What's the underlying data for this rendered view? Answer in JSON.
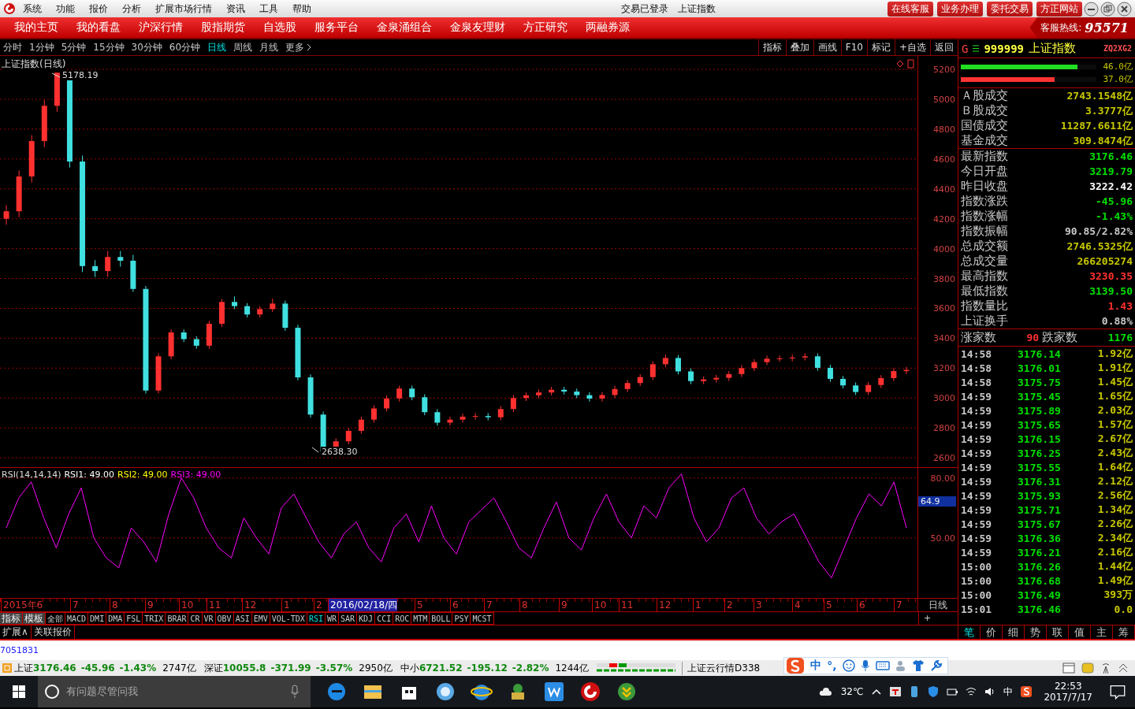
{
  "title_bar": {
    "menus": [
      "系统",
      "功能",
      "报价",
      "分析",
      "扩展市场行情",
      "资讯",
      "工具",
      "帮助"
    ],
    "status": "交易已登录",
    "security": "上证指数",
    "links": [
      "在线客服",
      "业务办理",
      "委托交易",
      "方正网站"
    ]
  },
  "nav": {
    "items": [
      "我的主页",
      "我的看盘",
      "沪深行情",
      "股指期货",
      "自选股",
      "服务平台",
      "金泉涌组合",
      "金泉友理财",
      "方正研究",
      "两融券源"
    ],
    "hotline_label": "客服热线:",
    "hotline": "95571"
  },
  "periods": [
    {
      "label": "分时",
      "selected": false
    },
    {
      "label": "1分钟",
      "selected": false
    },
    {
      "label": "5分钟",
      "selected": false
    },
    {
      "label": "15分钟",
      "selected": false
    },
    {
      "label": "30分钟",
      "selected": false
    },
    {
      "label": "60分钟",
      "selected": false
    },
    {
      "label": "日线",
      "selected": true
    },
    {
      "label": "周线",
      "selected": false
    },
    {
      "label": "月线",
      "selected": false
    },
    {
      "label": "更多",
      "selected": false
    }
  ],
  "chart_tools": [
    "指标",
    "叠加",
    "画线",
    "F10",
    "标记",
    "+自选",
    "返回"
  ],
  "quote_header": {
    "market": "G",
    "code": "999999",
    "name": "上证指数",
    "tag": "ZQ2XG2"
  },
  "flow_bars": [
    {
      "level": 0.86,
      "reading": "46.0亿",
      "color": "#22dd22"
    },
    {
      "level": 0.69,
      "reading": "37.0亿",
      "color": "#ff3333"
    }
  ],
  "turnover": [
    {
      "label": "Ａ股成交",
      "value": "2743.1548亿"
    },
    {
      "label": "Ｂ股成交",
      "value": "3.3777亿"
    },
    {
      "label": "国债成交",
      "value": "11287.6611亿"
    },
    {
      "label": "基金成交",
      "value": "309.8474亿"
    }
  ],
  "stats": [
    {
      "label": "最新指数",
      "value": "3176.46",
      "kind": "down"
    },
    {
      "label": "今日开盘",
      "value": "3219.79",
      "kind": "down"
    },
    {
      "label": "昨日收盘",
      "value": "3222.42",
      "kind": "flat"
    },
    {
      "label": "指数涨跌",
      "value": "-45.96",
      "kind": "down"
    },
    {
      "label": "指数涨幅",
      "value": "-1.43%",
      "kind": "down"
    },
    {
      "label": "指数振幅",
      "value": "90.85/2.82%",
      "kind": "plain"
    },
    {
      "label": "总成交额",
      "value": "2746.5325亿",
      "kind": "amount"
    },
    {
      "label": "总成交量",
      "value": "266205274",
      "kind": "amount"
    },
    {
      "label": "最高指数",
      "value": "3230.35",
      "kind": "up"
    },
    {
      "label": "最低指数",
      "value": "3139.50",
      "kind": "down"
    },
    {
      "label": "指数量比",
      "value": "1.43",
      "kind": "up"
    },
    {
      "label": "上证换手",
      "value": "0.88%",
      "kind": "plain"
    }
  ],
  "breadth": {
    "up_label": "涨家数",
    "up": "90",
    "down_label": "跌家数",
    "down": "1176"
  },
  "ticks": [
    {
      "time": "14:58",
      "price": "3176.14",
      "volume": "1.92亿"
    },
    {
      "time": "14:58",
      "price": "3176.01",
      "volume": "1.91亿"
    },
    {
      "time": "14:58",
      "price": "3175.75",
      "volume": "1.45亿"
    },
    {
      "time": "14:59",
      "price": "3175.45",
      "volume": "1.65亿"
    },
    {
      "time": "14:59",
      "price": "3175.89",
      "volume": "2.03亿"
    },
    {
      "time": "14:59",
      "price": "3175.65",
      "volume": "1.57亿"
    },
    {
      "time": "14:59",
      "price": "3176.15",
      "volume": "2.67亿"
    },
    {
      "time": "14:59",
      "price": "3176.25",
      "volume": "2.43亿"
    },
    {
      "time": "14:59",
      "price": "3175.55",
      "volume": "1.64亿"
    },
    {
      "time": "14:59",
      "price": "3176.31",
      "volume": "2.12亿"
    },
    {
      "time": "14:59",
      "price": "3175.93",
      "volume": "2.56亿"
    },
    {
      "time": "14:59",
      "price": "3175.71",
      "volume": "1.34亿"
    },
    {
      "time": "14:59",
      "price": "3175.67",
      "volume": "2.26亿"
    },
    {
      "time": "14:59",
      "price": "3176.36",
      "volume": "2.34亿"
    },
    {
      "time": "14:59",
      "price": "3176.21",
      "volume": "2.16亿"
    },
    {
      "time": "15:00",
      "price": "3176.26",
      "volume": "1.44亿"
    },
    {
      "time": "15:00",
      "price": "3176.68",
      "volume": "1.49亿"
    },
    {
      "time": "15:00",
      "price": "3176.49",
      "volume": "393万"
    },
    {
      "time": "15:01",
      "price": "3176.46",
      "volume": "0.0"
    }
  ],
  "detail_tabs": [
    {
      "label": "笔",
      "selected": true
    },
    {
      "label": "价",
      "selected": false
    },
    {
      "label": "细",
      "selected": false
    },
    {
      "label": "势",
      "selected": false
    },
    {
      "label": "联",
      "selected": false
    },
    {
      "label": "值",
      "selected": false
    },
    {
      "label": "主",
      "selected": false
    },
    {
      "label": "筹",
      "selected": false
    }
  ],
  "main_chart": {
    "title": "上证指数(日线)",
    "high": "5178.19",
    "low": "2638.30",
    "chart_data": {
      "type": "candlestick",
      "grid": true,
      "ylim": [
        2537,
        5290
      ],
      "yticks": [
        {
          "value": 5200,
          "label": "5200"
        },
        {
          "value": 5000,
          "label": "5000"
        },
        {
          "value": 4800,
          "label": "4800"
        },
        {
          "value": 4600,
          "label": "4600"
        },
        {
          "value": 4400,
          "label": "4400"
        },
        {
          "value": 4200,
          "label": "4200"
        },
        {
          "value": 4000,
          "label": "4000"
        },
        {
          "value": 3800,
          "label": "3800"
        },
        {
          "value": 3600,
          "label": "3600"
        },
        {
          "value": 3400,
          "label": "3400"
        },
        {
          "value": 3200,
          "label": "3200"
        },
        {
          "value": 3000,
          "label": "3000"
        },
        {
          "value": 2800,
          "label": "2800"
        },
        {
          "value": 2600,
          "label": "2600"
        }
      ],
      "categories": [
        null,
        null,
        null,
        null,
        null,
        null,
        null,
        null,
        null,
        null,
        null,
        null,
        null,
        null,
        null,
        null,
        null,
        null,
        null,
        null,
        null,
        null,
        null,
        null,
        null,
        null,
        null,
        null,
        null,
        null,
        null,
        null,
        null,
        null,
        null,
        null,
        null,
        null,
        null,
        null,
        null,
        null,
        null,
        null,
        null,
        null,
        null,
        null,
        null,
        null,
        null,
        null,
        null,
        null,
        null,
        null,
        null,
        null,
        null,
        null,
        null,
        null,
        null,
        null,
        null,
        null,
        null,
        null,
        null,
        null,
        null,
        null
      ],
      "ohlc": [
        [
          4200,
          4290,
          4160,
          4250
        ],
        [
          4250,
          4523,
          4210,
          4483
        ],
        [
          4483,
          4760,
          4443,
          4720
        ],
        [
          4720,
          4996,
          4680,
          4956
        ],
        [
          4956,
          5178,
          4916,
          5178
        ],
        [
          5178,
          5178,
          4543,
          4583
        ],
        [
          4583,
          4623,
          3843,
          3883
        ],
        [
          3883,
          3923,
          3810,
          3850
        ],
        [
          3850,
          3984,
          3810,
          3944
        ],
        [
          3944,
          3984,
          3879,
          3919
        ],
        [
          3919,
          3959,
          3710,
          3730
        ],
        [
          3730,
          3750,
          3030,
          3050
        ],
        [
          3050,
          3299,
          3030,
          3279
        ],
        [
          3279,
          3459,
          3259,
          3439
        ],
        [
          3439,
          3459,
          3374,
          3394
        ],
        [
          3394,
          3414,
          3330,
          3350
        ],
        [
          3350,
          3517,
          3330,
          3497
        ],
        [
          3497,
          3663,
          3477,
          3643
        ],
        [
          3643,
          3680,
          3595,
          3615
        ],
        [
          3615,
          3635,
          3539,
          3559
        ],
        [
          3559,
          3615,
          3539,
          3595
        ],
        [
          3595,
          3665,
          3575,
          3632
        ],
        [
          3632,
          3652,
          3450,
          3470
        ],
        [
          3470,
          3490,
          3118,
          3138
        ],
        [
          3138,
          3158,
          2869,
          2889
        ],
        [
          2889,
          2909,
          2638,
          2640
        ],
        [
          2640,
          2730,
          2638,
          2710
        ],
        [
          2710,
          2800,
          2690,
          2780
        ],
        [
          2780,
          2875,
          2760,
          2855
        ],
        [
          2855,
          2950,
          2835,
          2930
        ],
        [
          2930,
          3017,
          2910,
          2997
        ],
        [
          2997,
          3083,
          2977,
          3063
        ],
        [
          3063,
          3083,
          2985,
          3005
        ],
        [
          3005,
          3025,
          2885,
          2905
        ],
        [
          2905,
          2925,
          2815,
          2835
        ],
        [
          2835,
          2875,
          2815,
          2855
        ],
        [
          2855,
          2895,
          2835,
          2875
        ],
        [
          2875,
          2899,
          2855,
          2879
        ],
        [
          2879,
          2899,
          2851,
          2871
        ],
        [
          2871,
          2946,
          2851,
          2926
        ],
        [
          2926,
          3020,
          2906,
          3000
        ],
        [
          3000,
          3038,
          2980,
          3018
        ],
        [
          3018,
          3057,
          2998,
          3037
        ],
        [
          3037,
          3075,
          3017,
          3055
        ],
        [
          3055,
          3075,
          3023,
          3043
        ],
        [
          3043,
          3063,
          2999,
          3019
        ],
        [
          3019,
          3039,
          2976,
          2996
        ],
        [
          2996,
          3040,
          2976,
          3020
        ],
        [
          3020,
          3080,
          3000,
          3060
        ],
        [
          3060,
          3120,
          3040,
          3100
        ],
        [
          3100,
          3160,
          3080,
          3140
        ],
        [
          3140,
          3246,
          3120,
          3226
        ],
        [
          3226,
          3290,
          3206,
          3268
        ],
        [
          3268,
          3288,
          3158,
          3178
        ],
        [
          3178,
          3198,
          3093,
          3113
        ],
        [
          3113,
          3144,
          3093,
          3124
        ],
        [
          3124,
          3155,
          3104,
          3135
        ],
        [
          3135,
          3180,
          3115,
          3160
        ],
        [
          3160,
          3220,
          3140,
          3200
        ],
        [
          3200,
          3260,
          3180,
          3240
        ],
        [
          3240,
          3283,
          3220,
          3263
        ],
        [
          3263,
          3285,
          3243,
          3265
        ],
        [
          3265,
          3291,
          3245,
          3271
        ],
        [
          3271,
          3299,
          3251,
          3279
        ],
        [
          3279,
          3299,
          3182,
          3202
        ],
        [
          3202,
          3222,
          3108,
          3128
        ],
        [
          3128,
          3148,
          3064,
          3084
        ],
        [
          3084,
          3104,
          3020,
          3040
        ],
        [
          3040,
          3107,
          3020,
          3087
        ],
        [
          3087,
          3153,
          3067,
          3133
        ],
        [
          3133,
          3200,
          3113,
          3180
        ],
        [
          3180,
          3208,
          3160,
          3188
        ]
      ]
    }
  },
  "rsi": {
    "label": "RSI(14,14,14)",
    "series": [
      {
        "label": "RSI1: 49.00",
        "color": "#ffffff"
      },
      {
        "label": "RSI2: 49.00",
        "color": "#ffff00"
      },
      {
        "label": "RSI3: 49.00",
        "color": "#ff00ff"
      }
    ],
    "current": "64.9",
    "chart_data": {
      "type": "line",
      "grid": true,
      "ylim": [
        20,
        85
      ],
      "yticks": [
        {
          "value": 80,
          "label": "80.00"
        },
        {
          "value": 50,
          "label": "50.00"
        }
      ],
      "categories": [
        null,
        null,
        null,
        null,
        null,
        null,
        null,
        null,
        null,
        null,
        null,
        null,
        null,
        null,
        null,
        null,
        null,
        null,
        null,
        null,
        null,
        null,
        null,
        null,
        null,
        null,
        null,
        null,
        null,
        null,
        null,
        null,
        null,
        null,
        null,
        null,
        null,
        null,
        null,
        null,
        null,
        null,
        null,
        null,
        null,
        null,
        null,
        null,
        null,
        null,
        null,
        null,
        null,
        null,
        null,
        null,
        null,
        null,
        null,
        null,
        null,
        null,
        null,
        null,
        null,
        null,
        null,
        null,
        null,
        null,
        null,
        null,
        null
      ],
      "series": [
        {
          "color": "#ff00ff",
          "values": [
            55,
            70,
            78,
            60,
            45,
            62,
            75,
            50,
            40,
            35,
            55,
            48,
            38,
            62,
            80,
            70,
            55,
            45,
            40,
            60,
            50,
            42,
            65,
            72,
            60,
            48,
            40,
            52,
            58,
            45,
            38,
            55,
            62,
            48,
            66,
            50,
            42,
            58,
            64,
            70,
            58,
            45,
            40,
            55,
            68,
            50,
            44,
            60,
            72,
            58,
            50,
            66,
            60,
            75,
            82,
            60,
            48,
            55,
            70,
            75,
            60,
            52,
            58,
            62,
            50,
            38,
            30,
            45,
            60,
            72,
            66,
            78,
            55
          ]
        }
      ]
    }
  },
  "date_axis": {
    "labels": [
      {
        "label": "2015年6",
        "selected": false
      },
      {
        "label": "7",
        "selected": false
      },
      {
        "label": "8",
        "selected": false
      },
      {
        "label": "9",
        "selected": false
      },
      {
        "label": "10",
        "selected": false
      },
      {
        "label": "11",
        "selected": false
      },
      {
        "label": "12",
        "selected": false
      },
      {
        "label": "1",
        "selected": false
      },
      {
        "label": "2",
        "selected": false
      },
      {
        "label": "2016/02/18/四",
        "selected": true
      },
      {
        "label": "5",
        "selected": false
      },
      {
        "label": "6",
        "selected": false
      },
      {
        "label": "7",
        "selected": false
      },
      {
        "label": "8",
        "selected": false
      },
      {
        "label": "9",
        "selected": false
      },
      {
        "label": "10",
        "selected": false
      },
      {
        "label": "11",
        "selected": false
      },
      {
        "label": "12",
        "selected": false
      },
      {
        "label": "1",
        "selected": false
      },
      {
        "label": "2",
        "selected": false
      },
      {
        "label": "3",
        "selected": false
      },
      {
        "label": "4",
        "selected": false
      },
      {
        "label": "5",
        "selected": false
      },
      {
        "label": "6",
        "selected": false
      },
      {
        "label": "7",
        "selected": false
      }
    ],
    "period": "日线",
    "add": "+"
  },
  "indicator_tabs": [
    {
      "label": "指标",
      "kind": "mode",
      "selected": false
    },
    {
      "label": "模板",
      "kind": "mode",
      "selected": false
    },
    {
      "label": "全部",
      "kind": "indicator",
      "selected": false
    },
    {
      "label": "MACD",
      "kind": "indicator",
      "selected": false
    },
    {
      "label": "DMI",
      "kind": "indicator",
      "selected": false
    },
    {
      "label": "DMA",
      "kind": "indicator",
      "selected": false
    },
    {
      "label": "FSL",
      "kind": "indicator",
      "selected": false
    },
    {
      "label": "TRIX",
      "kind": "indicator",
      "selected": false
    },
    {
      "label": "BRAR",
      "kind": "indicator",
      "selected": false
    },
    {
      "label": "CR",
      "kind": "indicator",
      "selected": false
    },
    {
      "label": "VR",
      "kind": "indicator",
      "selected": false
    },
    {
      "label": "OBV",
      "kind": "indicator",
      "selected": false
    },
    {
      "label": "ASI",
      "kind": "indicator",
      "selected": false
    },
    {
      "label": "EMV",
      "kind": "indicator",
      "selected": false
    },
    {
      "label": "VOL-TDX",
      "kind": "indicator",
      "selected": false
    },
    {
      "label": "RSI",
      "kind": "indicator",
      "selected": true
    },
    {
      "label": "WR",
      "kind": "indicator",
      "selected": false
    },
    {
      "label": "SAR",
      "kind": "indicator",
      "selected": false
    },
    {
      "label": "KDJ",
      "kind": "indicator",
      "selected": false
    },
    {
      "label": "CCI",
      "kind": "indicator",
      "selected": false
    },
    {
      "label": "ROC",
      "kind": "indicator",
      "selected": false
    },
    {
      "label": "MTM",
      "kind": "indicator",
      "selected": false
    },
    {
      "label": "BOLL",
      "kind": "indicator",
      "selected": false
    },
    {
      "label": "PSY",
      "kind": "indicator",
      "selected": false
    },
    {
      "label": "MCST",
      "kind": "indicator",
      "selected": false
    }
  ],
  "extras": [
    "扩展∧",
    "关联报价"
  ],
  "code_strip": "7051831",
  "status_bar": {
    "indices": [
      {
        "name": "上证",
        "value": "3176.46",
        "change": "-45.96",
        "pct": "-1.43%",
        "amount": "2747亿"
      },
      {
        "name": "深证",
        "value": "10055.8",
        "change": "-371.99",
        "pct": "-3.57%",
        "amount": "2950亿"
      },
      {
        "name": "中小",
        "value": "6721.52",
        "change": "-195.12",
        "pct": "-2.82%",
        "amount": "1244亿"
      }
    ],
    "feed": "上证云行情D338"
  },
  "ime_toolbar": {
    "mode": "中",
    "punct": "°,"
  },
  "taskbar": {
    "search": "有问题尽管问我",
    "weather": "32℃",
    "ime": "中",
    "time": "22:53",
    "date": "2017/7/17"
  }
}
